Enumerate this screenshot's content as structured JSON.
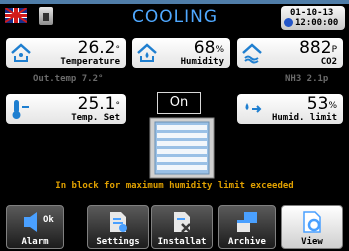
{
  "header": {
    "title": "COOLING",
    "date": "01-10-13",
    "time": "12:00:00"
  },
  "tiles": {
    "temperature": {
      "value": "26.2",
      "unit": "°",
      "label": "Temperature"
    },
    "humidity": {
      "value": "68",
      "unit": "%",
      "label": "Humidity"
    },
    "co2": {
      "value": "882",
      "unit": "P",
      "label": "CO2"
    },
    "temp_set": {
      "value": "25.1",
      "unit": "°",
      "label": "Temp. Set"
    },
    "humid_limit": {
      "value": "53",
      "unit": "%",
      "label": "Humid. limit"
    }
  },
  "secondary": {
    "out_temp": "Out.temp  7.2°",
    "nh3": "NH3  2.1p"
  },
  "status": {
    "on_label": "On",
    "warning": "In block for maximum humidity limit exceeded"
  },
  "nav": {
    "items": [
      {
        "label": "Alarm",
        "badge": "Ok"
      },
      {
        "label": "Settings"
      },
      {
        "label": "Installat"
      },
      {
        "label": "Archive"
      },
      {
        "label": "View"
      }
    ]
  },
  "colors": {
    "title": "#4fa8ff",
    "warning": "#e0a000",
    "icon_blue": "#1f7fd0",
    "frame": "#4f7da8"
  }
}
